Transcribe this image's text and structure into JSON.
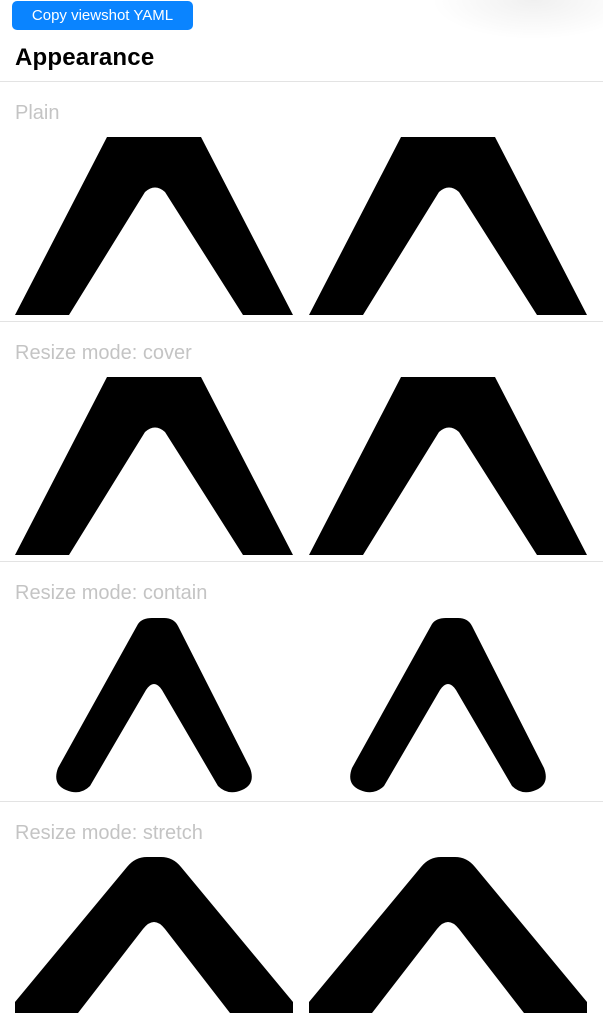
{
  "toolbar": {
    "copy_button_label": "Copy viewshot YAML"
  },
  "header": {
    "title": "Appearance"
  },
  "sections": [
    {
      "label": "Plain"
    },
    {
      "label": "Resize mode: cover"
    },
    {
      "label": "Resize mode: contain"
    },
    {
      "label": "Resize mode: stretch"
    }
  ],
  "icons": {
    "logo": "chevron-logo-icon"
  },
  "colors": {
    "button": "#0a84ff",
    "label": "#c4c4c4",
    "logo": "#000000"
  }
}
